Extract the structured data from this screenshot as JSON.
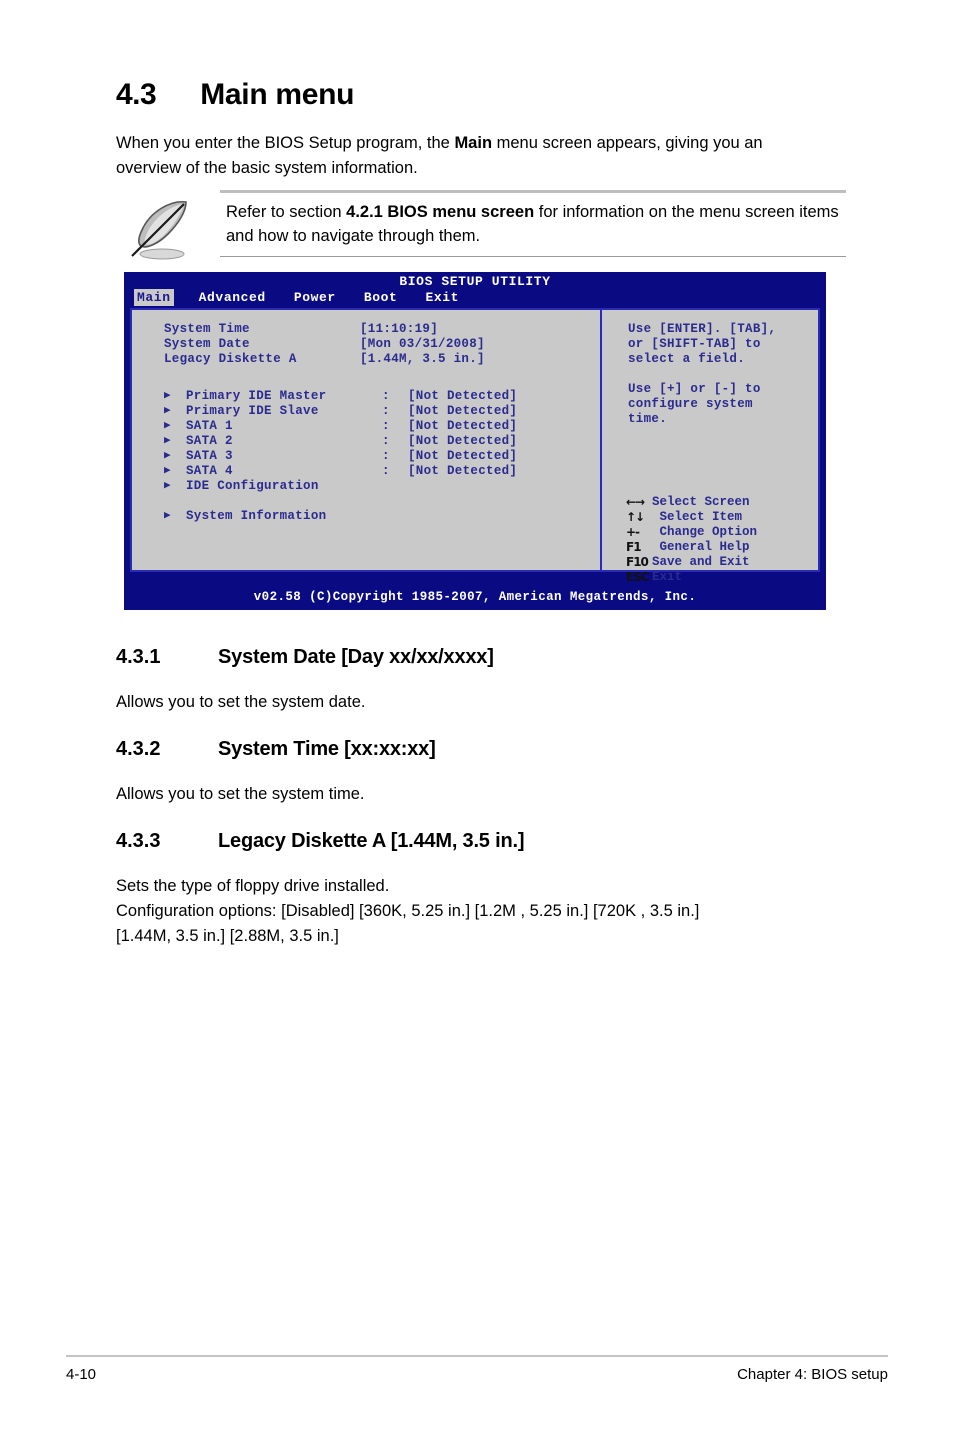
{
  "section": {
    "number": "4.3",
    "title": "Main menu",
    "intro_before": "When you enter the BIOS Setup program, the ",
    "intro_bold": "Main",
    "intro_after": " menu screen appears, giving you an overview of the basic system information."
  },
  "note": {
    "icon": "feather-pen-icon",
    "text_before": "Refer to section ",
    "text_bold": "4.2.1 BIOS menu screen",
    "text_after": " for information on the menu screen items and how to navigate through them."
  },
  "bios": {
    "title": "BIOS SETUP UTILITY",
    "tabs": [
      {
        "label": "Main",
        "active": true
      },
      {
        "label": "Advanced",
        "active": false
      },
      {
        "label": "Power",
        "active": false
      },
      {
        "label": "Boot",
        "active": false
      },
      {
        "label": "Exit",
        "active": false
      }
    ],
    "fields": [
      {
        "label": "System Time",
        "value": "[11:10:19]"
      },
      {
        "label": "System Date",
        "value": "[Mon 03/31/2008]"
      },
      {
        "label": "Legacy Diskette A",
        "value": "[1.44M, 3.5 in.]"
      }
    ],
    "devices": [
      {
        "arrow": "▶",
        "label": "Primary IDE Master",
        "colon": ":",
        "value": "[Not Detected]"
      },
      {
        "arrow": "▶",
        "label": "Primary IDE Slave",
        "colon": ":",
        "value": "[Not Detected]"
      },
      {
        "arrow": "▶",
        "label": "SATA 1",
        "colon": ":",
        "value": "[Not Detected]"
      },
      {
        "arrow": "▶",
        "label": "SATA 2",
        "colon": ":",
        "value": "[Not Detected]"
      },
      {
        "arrow": "▶",
        "label": "SATA 3",
        "colon": ":",
        "value": "[Not Detected]"
      },
      {
        "arrow": "▶",
        "label": "SATA 4",
        "colon": ":",
        "value": "[Not Detected]"
      },
      {
        "arrow": "▶",
        "label": "IDE Configuration",
        "colon": "",
        "value": ""
      }
    ],
    "submenus": [
      {
        "arrow": "▶",
        "label": "System Information"
      }
    ],
    "help": {
      "para1": [
        "Use [ENTER]. [TAB],",
        "or [SHIFT-TAB] to",
        "select a field."
      ],
      "para2": [
        "Use [+] or [-] to",
        "configure system",
        "time."
      ]
    },
    "keys": [
      {
        "glyph": "←→",
        "label": "Select Screen"
      },
      {
        "glyph": "↑↓",
        "label": " Select Item"
      },
      {
        "glyph": "+-",
        "label": " Change Option"
      },
      {
        "glyph": "F1",
        "label": " General Help"
      },
      {
        "glyph": "F10",
        "label": "Save and Exit"
      },
      {
        "glyph": "ESC",
        "label": "Exit"
      }
    ],
    "footer": "v02.58 (C)Copyright 1985-2007, American Megatrends, Inc."
  },
  "sub_sections": [
    {
      "number": "4.3.1",
      "title": "System Date [Day xx/xx/xxxx]",
      "body": "Allows you to set the system date."
    },
    {
      "number": "4.3.2",
      "title": "System Time [xx:xx:xx]",
      "body": "Allows you to set the system time."
    },
    {
      "number": "4.3.3",
      "title": "Legacy Diskette A [1.44M, 3.5 in.]",
      "body_line1": "Sets the type of floppy drive installed.",
      "body_line2": "Configuration options: [Disabled] [360K, 5.25 in.] [1.2M , 5.25 in.] [720K , 3.5 in.]",
      "body_line3": "[1.44M, 3.5 in.] [2.88M, 3.5 in.]"
    }
  ],
  "page_footer": {
    "page_number": "4-10",
    "chapter": "Chapter 4: BIOS setup"
  }
}
